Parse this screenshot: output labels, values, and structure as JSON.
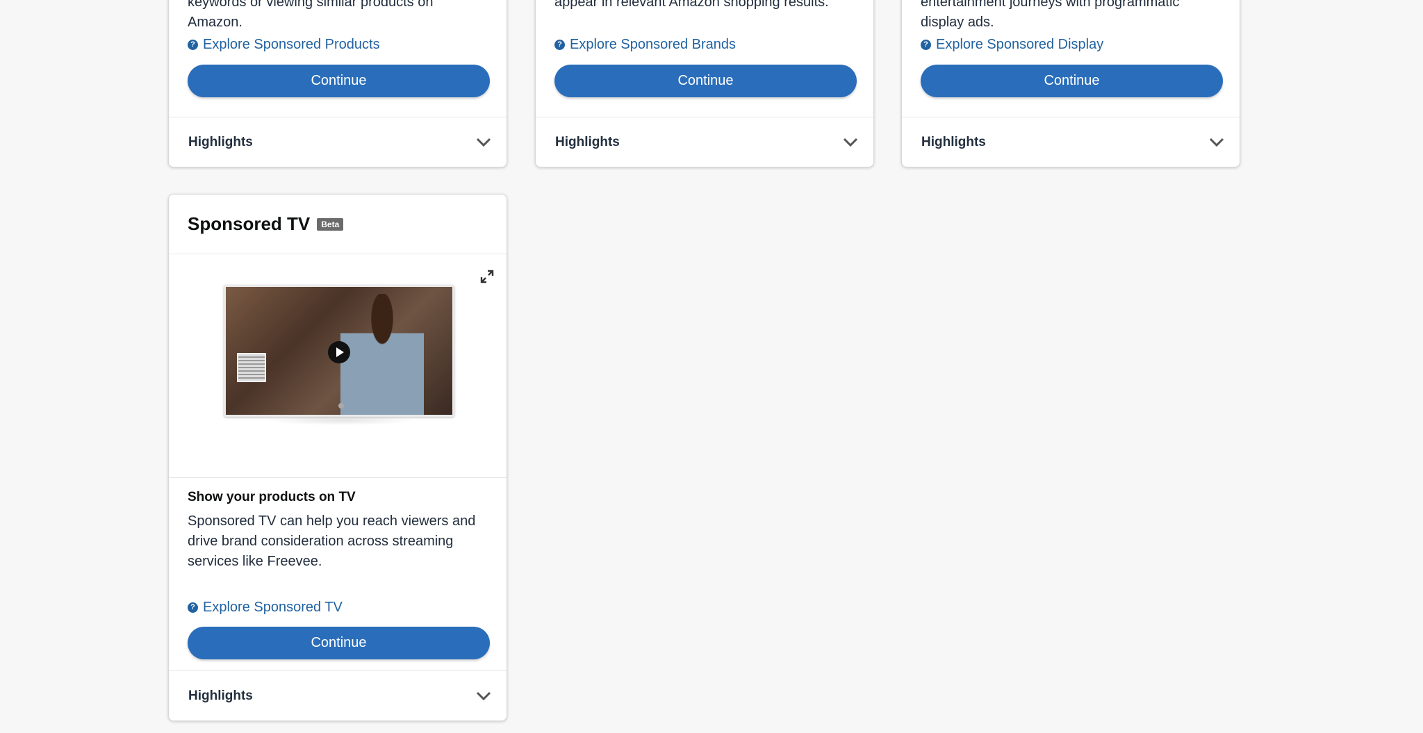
{
  "cards_top": [
    {
      "desc_lines": [
        "keywords or viewing similar products on",
        "Amazon."
      ],
      "explore_label": "Explore Sponsored Products",
      "continue_label": "Continue",
      "highlights_label": "Highlights"
    },
    {
      "desc_lines": [
        "appear in relevant Amazon shopping results.",
        ""
      ],
      "explore_label": "Explore Sponsored Brands",
      "continue_label": "Continue",
      "highlights_label": "Highlights"
    },
    {
      "desc_lines": [
        "entertainment journeys with programmatic",
        "display ads."
      ],
      "explore_label": "Explore Sponsored Display",
      "continue_label": "Continue",
      "highlights_label": "Highlights"
    }
  ],
  "tv_card": {
    "title": "Sponsored TV",
    "badge": "Beta",
    "subtitle": "Show your products on TV",
    "desc_lines": [
      "Sponsored TV can help you reach viewers and",
      "drive brand consideration across streaming",
      "services like Freevee."
    ],
    "explore_label": "Explore Sponsored TV",
    "continue_label": "Continue",
    "highlights_label": "Highlights"
  },
  "icons": {
    "help": "question-circle-icon",
    "chevron": "chevron-down-icon",
    "expand": "expand-icon",
    "play": "play-icon"
  },
  "colors": {
    "background": "#f7f7f7",
    "link": "#2162a1",
    "button": "#2a6ebb",
    "text": "#232f3e"
  }
}
